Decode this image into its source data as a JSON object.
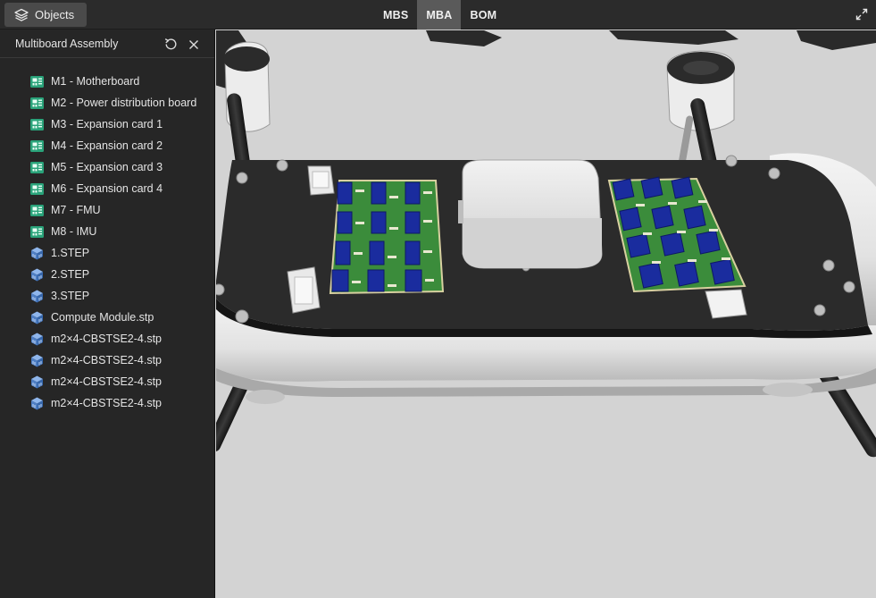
{
  "topbar": {
    "objects_label": "Objects",
    "tabs": [
      {
        "label": "MBS",
        "active": false
      },
      {
        "label": "MBA",
        "active": true
      },
      {
        "label": "BOM",
        "active": false
      }
    ]
  },
  "panel": {
    "title": "Multiboard Assembly",
    "items": [
      {
        "label": "M1 - Motherboard",
        "icon": "pcb-board-icon"
      },
      {
        "label": "M2 - Power distribution board",
        "icon": "pcb-board-icon"
      },
      {
        "label": "M3 - Expansion card 1",
        "icon": "pcb-board-icon"
      },
      {
        "label": "M4 - Expansion card 2",
        "icon": "pcb-board-icon"
      },
      {
        "label": "M5 - Expansion card 3",
        "icon": "pcb-board-icon"
      },
      {
        "label": "M6 - Expansion card 4",
        "icon": "pcb-board-icon"
      },
      {
        "label": "M7 - FMU",
        "icon": "pcb-board-icon"
      },
      {
        "label": "M8 - IMU",
        "icon": "pcb-board-icon"
      },
      {
        "label": "1.STEP",
        "icon": "3d-model-icon"
      },
      {
        "label": "2.STEP",
        "icon": "3d-model-icon"
      },
      {
        "label": "3.STEP",
        "icon": "3d-model-icon"
      },
      {
        "label": "Compute Module.stp",
        "icon": "3d-model-icon"
      },
      {
        "label": "m2×4-CBSTSE2-4.stp",
        "icon": "3d-model-icon"
      },
      {
        "label": "m2×4-CBSTSE2-4.stp",
        "icon": "3d-model-icon"
      },
      {
        "label": "m2×4-CBSTSE2-4.stp",
        "icon": "3d-model-icon"
      },
      {
        "label": "m2×4-CBSTSE2-4.stp",
        "icon": "3d-model-icon"
      }
    ]
  },
  "colors": {
    "topbar": "#2b2b2b",
    "panel": "#262626",
    "viewport": "#d3d3d3",
    "pcb_green": "#3a8a3a",
    "component_blue": "#1a2c9e",
    "icon_teal": "#2aa37a",
    "icon_blue": "#5b8fd6"
  }
}
